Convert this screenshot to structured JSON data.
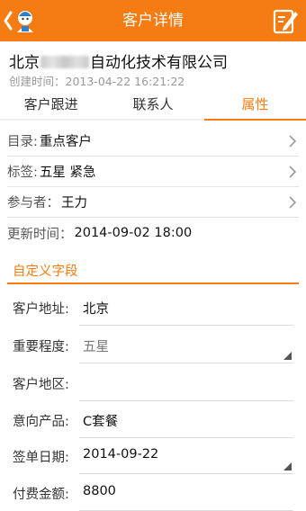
{
  "header": {
    "title": "客户详情",
    "back_icon": "back-arrow-with-mascot-icon",
    "edit_icon": "edit-icon",
    "color": "#f47c12"
  },
  "customer": {
    "name_prefix": "北京",
    "name_suffix": "自动化技术有限公司",
    "created": "创建时间：2013-04-22 16:21:22"
  },
  "tabs": [
    {
      "label": "客户跟进"
    },
    {
      "label": "联系人"
    },
    {
      "label": "属性",
      "active": true
    }
  ],
  "properties": {
    "catalog": {
      "label": "目录:",
      "value": "重点客户"
    },
    "tags": {
      "label": "标签:",
      "value": "五星 紧急"
    },
    "participants": {
      "label": "参与者：",
      "value": "王力"
    },
    "updated": {
      "label": "更新时间：",
      "value": "2014-09-02 18:00"
    }
  },
  "custom_section": {
    "title": "自定义字段"
  },
  "custom_fields": {
    "address": {
      "label": "客户地址:",
      "value": "北京"
    },
    "importance": {
      "label": "重要程度:",
      "value": "五星"
    },
    "region": {
      "label": "客户地区:",
      "value": ""
    },
    "product": {
      "label": "意向产品:",
      "value": "C套餐"
    },
    "sign_date": {
      "label": "签单日期:",
      "value": "2014-09-22"
    },
    "amount": {
      "label": "付费金额:",
      "value": "8800"
    }
  }
}
